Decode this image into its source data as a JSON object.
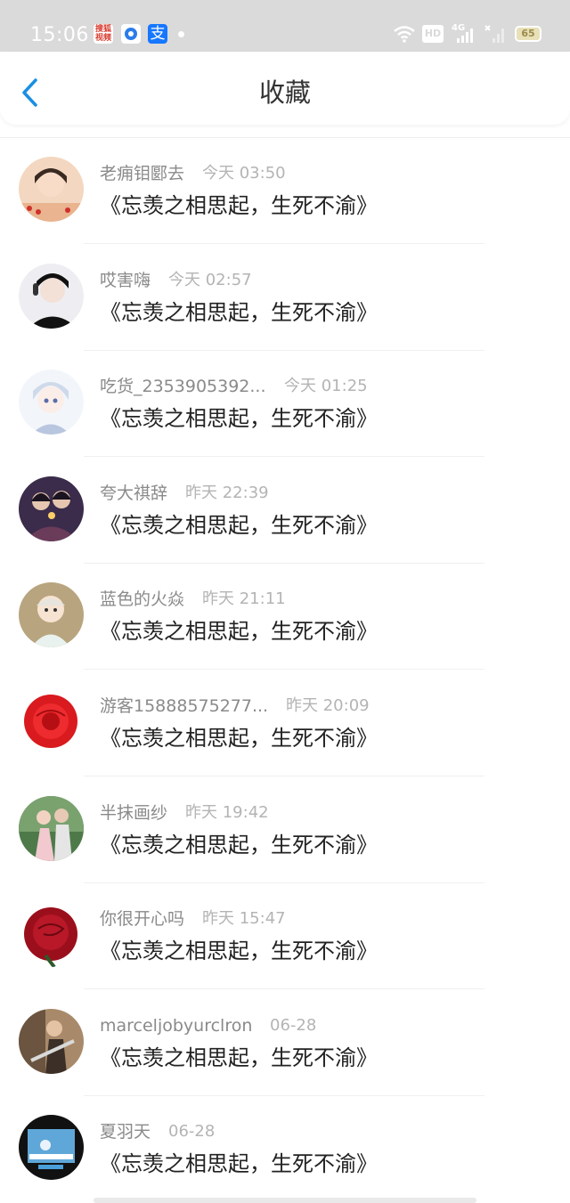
{
  "status_bar": {
    "time": "15:06",
    "apps": [
      {
        "name": "sohu-video-app-icon",
        "label": "搜狐视频",
        "color": "#d83b2f"
      },
      {
        "name": "browser-app-icon",
        "label": "",
        "color": "#2b7de9"
      },
      {
        "name": "alipay-app-icon",
        "label": "支",
        "color": "#1677ff"
      }
    ],
    "battery": "65",
    "network": "4G",
    "hd": "HD"
  },
  "header": {
    "title": "收藏",
    "back_icon": "chevron-left-icon",
    "accent_color": "#1a8fe3"
  },
  "items": [
    {
      "username": "老痈钼郾去",
      "time": "今天 03:50",
      "title": "《忘羡之相思起，生死不渝》"
    },
    {
      "username": "哎害嗨",
      "time": "今天 02:57",
      "title": "《忘羡之相思起，生死不渝》"
    },
    {
      "username": "吃货_2353905392...",
      "time": "今天 01:25",
      "title": "《忘羡之相思起，生死不渝》"
    },
    {
      "username": "夸大祺辞",
      "time": "昨天 22:39",
      "title": "《忘羡之相思起，生死不渝》"
    },
    {
      "username": "蓝色的火焱",
      "time": "昨天 21:11",
      "title": "《忘羡之相思起，生死不渝》"
    },
    {
      "username": "游客15888575277...",
      "time": "昨天 20:09",
      "title": "《忘羡之相思起，生死不渝》"
    },
    {
      "username": "半抹画纱",
      "time": "昨天 19:42",
      "title": "《忘羡之相思起，生死不渝》"
    },
    {
      "username": "你很开心吗",
      "time": "昨天 15:47",
      "title": "《忘羡之相思起，生死不渝》"
    },
    {
      "username": "marceljobyurclron",
      "time": "06-28",
      "title": "《忘羡之相思起，生死不渝》"
    },
    {
      "username": "夏羽天",
      "time": "06-28",
      "title": "《忘羡之相思起，生死不渝》"
    }
  ]
}
